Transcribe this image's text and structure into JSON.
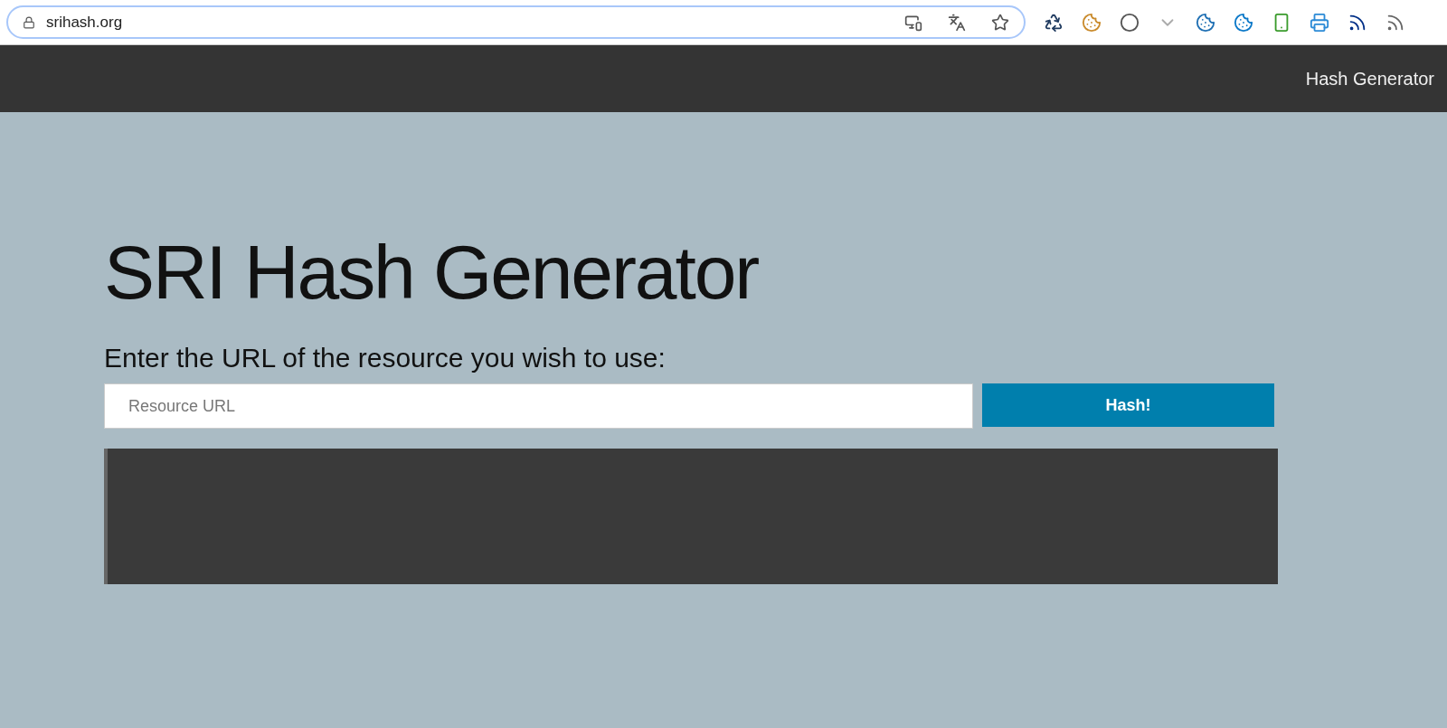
{
  "browser": {
    "url": "srihash.org"
  },
  "navbar": {
    "link": "Hash Generator"
  },
  "main": {
    "title": "SRI Hash Generator",
    "prompt": "Enter the URL of the resource you wish to use:",
    "url_field": {
      "placeholder": "Resource URL"
    },
    "button": "Hash!"
  }
}
